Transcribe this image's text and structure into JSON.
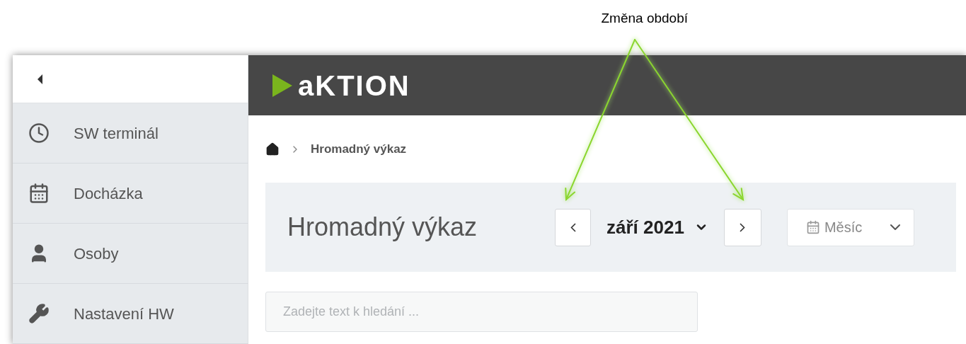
{
  "annotation": {
    "text": "Změna období"
  },
  "header": {
    "logo": "aKTION"
  },
  "sidebar": {
    "items": [
      {
        "label": "SW terminál"
      },
      {
        "label": "Docházka"
      },
      {
        "label": "Osoby"
      },
      {
        "label": "Nastavení HW"
      }
    ]
  },
  "breadcrumb": {
    "items": [
      "Hromadný výkaz"
    ]
  },
  "page": {
    "title": "Hromadný výkaz",
    "period": "září 2021",
    "view": "Měsíc"
  },
  "search": {
    "placeholder": "Zadejte text k hledání ..."
  }
}
